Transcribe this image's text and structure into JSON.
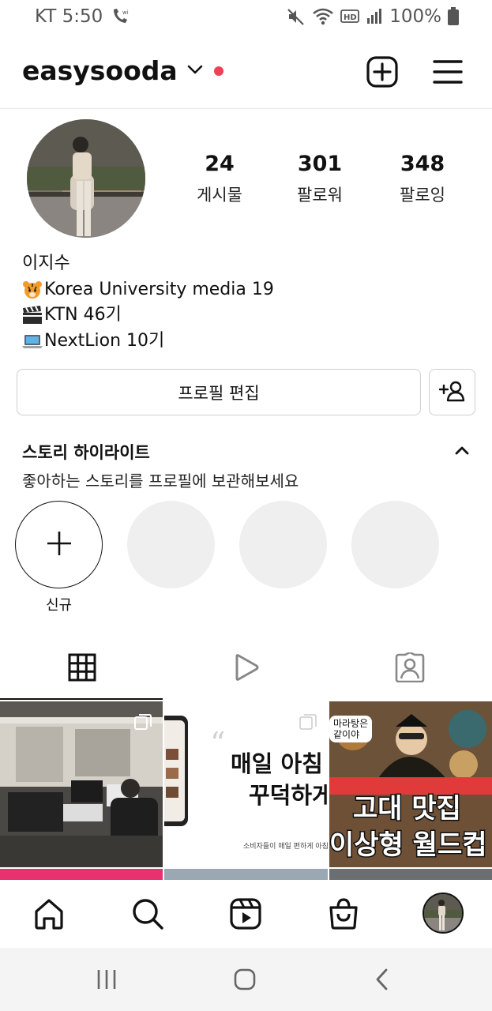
{
  "status_bar": {
    "carrier_time": "KT 5:50",
    "battery": "100%",
    "icons": [
      "wifi-call-icon",
      "mute-icon",
      "wifi-icon",
      "hd-icon",
      "signal-icon",
      "battery-icon"
    ]
  },
  "header": {
    "username": "easysooda",
    "icons": [
      "chevron-down-icon",
      "new-post-icon",
      "menu-icon"
    ],
    "dot_color": "#ef4056"
  },
  "profile": {
    "stats": [
      {
        "value": "24",
        "label": "게시물"
      },
      {
        "value": "301",
        "label": "팔로워"
      },
      {
        "value": "348",
        "label": "팔로잉"
      }
    ],
    "name": "이지수",
    "bio": [
      {
        "icon": "tiger-emoji",
        "text": "Korea University media 19"
      },
      {
        "icon": "clapper-emoji",
        "text": "KTN 46기"
      },
      {
        "icon": "laptop-emoji",
        "text": "NextLion 10기"
      }
    ],
    "edit_button": "프로필 편집"
  },
  "highlights": {
    "title": "스토리 하이라이트",
    "subtitle": "좋아하는 스토리를 프로필에 보관해보세요",
    "new_label": "신규"
  },
  "tabs": [
    "grid-icon",
    "reels-icon",
    "tagged-icon"
  ],
  "grid": {
    "posts": [
      {
        "kind": "office-photo"
      },
      {
        "kind": "article",
        "headline_1": "매일 아침",
        "headline_2": "꾸덕하게",
        "caption": "소비자들이 매일 편하게 아침을 챙길 수"
      },
      {
        "kind": "food-worldcup",
        "bubble_1": "마라탕은",
        "bubble_2": "같이야",
        "title_1": "고대 맛집",
        "title_2": "이상형 월드컵"
      }
    ]
  },
  "bottom_nav": [
    "home-icon",
    "search-icon",
    "reels-icon",
    "shop-icon",
    "profile-avatar"
  ],
  "colors": {
    "accent": "#ef4056",
    "border": "#dbdbdb",
    "placeholder": "#efefef",
    "pink_strip": "#e8316f"
  }
}
